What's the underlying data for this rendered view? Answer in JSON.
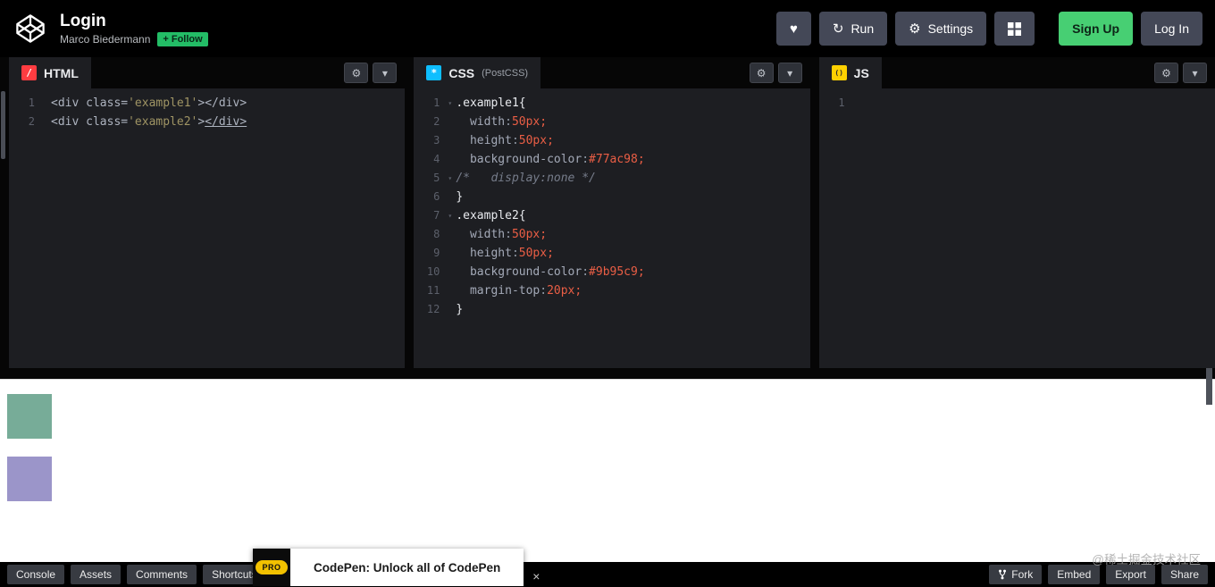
{
  "colors": {
    "accent_green": "#47cf73",
    "html_icon_bg": "#ff3c41",
    "css_icon_bg": "#0ebeff",
    "js_icon_bg": "#fcd000",
    "editor_bg": "#1d1e22",
    "value_orange": "#ea5e45"
  },
  "icons": {
    "gear": "⚙",
    "chevron_down": "▾",
    "heart": "♥",
    "run_refresh": "↻",
    "close": "×",
    "fold": "▾",
    "html_glyph": "/",
    "css_glyph": "*",
    "js_glyph": "()"
  },
  "header": {
    "pen_title": "Login",
    "author_name": "Marco Biedermann",
    "follow_label": "+ Follow",
    "run_label": "Run",
    "settings_label": "Settings",
    "signup_label": "Sign Up",
    "login_label": "Log In"
  },
  "editors": [
    {
      "id": "html",
      "label": "HTML",
      "sublabel": "",
      "lines": [
        {
          "num": 1,
          "tokens": [
            [
              "tag",
              "<div class="
            ],
            [
              "str",
              "'example1'"
            ],
            [
              "tag",
              "></div>"
            ]
          ]
        },
        {
          "num": 2,
          "tokens": [
            [
              "tag",
              "<div class="
            ],
            [
              "str",
              "'example2'"
            ],
            [
              "tag",
              ">"
            ],
            [
              "tag und",
              "</div>"
            ]
          ]
        }
      ]
    },
    {
      "id": "css",
      "label": "CSS",
      "sublabel": "(PostCSS)",
      "lines": [
        {
          "num": 1,
          "fold": true,
          "tokens": [
            [
              "sel",
              ".example1{"
            ]
          ]
        },
        {
          "num": 2,
          "tokens": [
            [
              "prop",
              "  width"
            ],
            [
              "pun",
              ":"
            ],
            [
              "num",
              "50px;"
            ]
          ]
        },
        {
          "num": 3,
          "tokens": [
            [
              "prop",
              "  height"
            ],
            [
              "pun",
              ":"
            ],
            [
              "num",
              "50px;"
            ]
          ]
        },
        {
          "num": 4,
          "tokens": [
            [
              "prop",
              "  background-color"
            ],
            [
              "pun",
              ":"
            ],
            [
              "num",
              "#77ac98;"
            ]
          ]
        },
        {
          "num": 5,
          "fold": true,
          "tokens": [
            [
              "com",
              "/*   display:none */"
            ]
          ]
        },
        {
          "num": 6,
          "tokens": [
            [
              "sel",
              "}"
            ]
          ]
        },
        {
          "num": 7,
          "fold": true,
          "tokens": [
            [
              "sel",
              ".example2{"
            ]
          ]
        },
        {
          "num": 8,
          "tokens": [
            [
              "prop",
              "  width"
            ],
            [
              "pun",
              ":"
            ],
            [
              "num",
              "50px;"
            ]
          ]
        },
        {
          "num": 9,
          "tokens": [
            [
              "prop",
              "  height"
            ],
            [
              "pun",
              ":"
            ],
            [
              "num",
              "50px;"
            ]
          ]
        },
        {
          "num": 10,
          "tokens": [
            [
              "prop",
              "  background-color"
            ],
            [
              "pun",
              ":"
            ],
            [
              "num",
              "#9b95c9;"
            ]
          ]
        },
        {
          "num": 11,
          "tokens": [
            [
              "prop",
              "  margin-top"
            ],
            [
              "pun",
              ":"
            ],
            [
              "num",
              "20px;"
            ]
          ]
        },
        {
          "num": 12,
          "tokens": [
            [
              "sel",
              "}"
            ]
          ]
        }
      ]
    },
    {
      "id": "js",
      "label": "JS",
      "sublabel": "",
      "lines": [
        {
          "num": 1,
          "tokens": []
        }
      ]
    }
  ],
  "preview": {
    "box1_color": "#77ac98",
    "box2_color": "#9b95c9"
  },
  "footer": {
    "left_buttons": [
      "Console",
      "Assets",
      "Comments",
      "Shortcuts"
    ],
    "right_buttons": [
      "Fork",
      "Embed",
      "Export",
      "Share"
    ],
    "popup": {
      "badge": "PRO",
      "text": "CodePen: Unlock all of CodePen"
    }
  },
  "watermark": "@稀土掘金技术社区"
}
